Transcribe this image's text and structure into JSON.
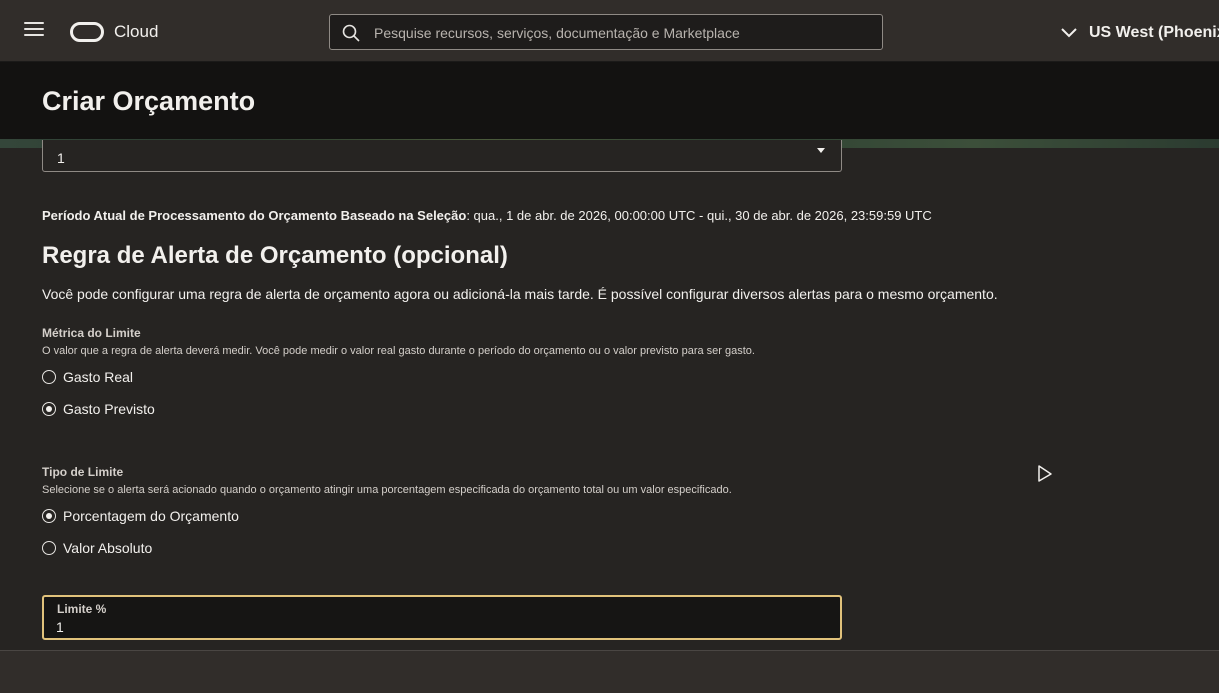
{
  "topbar": {
    "brand": "Cloud",
    "search_placeholder": "Pesquise recursos, serviços, documentação e Marketplace",
    "region": "US West (Phoenix"
  },
  "page": {
    "title": "Criar Orçamento"
  },
  "form": {
    "select_value": "1",
    "period_label": "Período Atual de Processamento do Orçamento Baseado na Seleção",
    "period_value": ": qua., 1 de abr. de 2026, 00:00:00 UTC - qui., 30 de abr. de 2026, 23:59:59 UTC",
    "alert_section": {
      "title": "Regra de Alerta de Orçamento (opcional)",
      "description": "Você pode configurar uma regra de alerta de orçamento agora ou adicioná-la mais tarde. É possível configurar diversos alertas para o mesmo orçamento."
    },
    "threshold_metric": {
      "label": "Métrica do Limite",
      "help": "O valor que a regra de alerta deverá medir. Você pode medir o valor real gasto durante o período do orçamento ou o valor previsto para ser gasto.",
      "options": [
        "Gasto Real",
        "Gasto Previsto"
      ],
      "selected": "Gasto Previsto"
    },
    "threshold_type": {
      "label": "Tipo de Limite",
      "help": "Selecione se o alerta será acionado quando o orçamento atingir uma porcentagem especificada do orçamento total ou um valor especificado.",
      "options": [
        "Porcentagem do Orçamento",
        "Valor Absoluto"
      ],
      "selected": "Porcentagem do Orçamento"
    },
    "limit": {
      "label": "Limite %",
      "value": "1"
    }
  },
  "colors": {
    "topbar_bg": "#312d2a",
    "titlebar_bg": "#131211",
    "content_bg": "#262422",
    "focus_border": "#e1c27b"
  }
}
